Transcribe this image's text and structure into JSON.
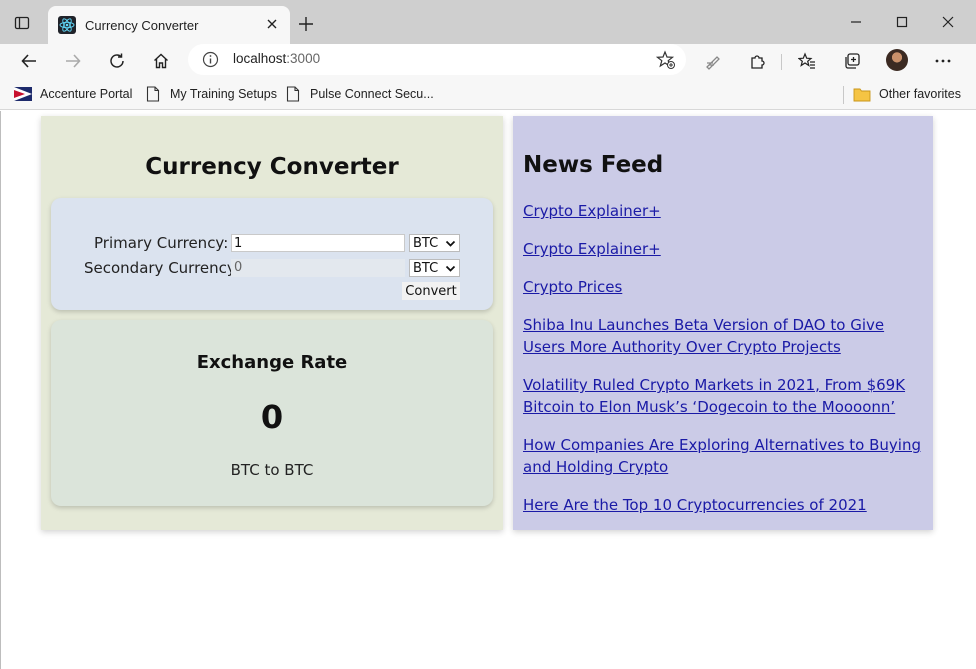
{
  "browser": {
    "tab": {
      "title": "Currency Converter"
    },
    "address": {
      "host": "localhost",
      "port": ":3000"
    },
    "bookmarks": [
      {
        "label": "Accenture Portal"
      },
      {
        "label": "My Training Setups"
      },
      {
        "label": "Pulse Connect Secu..."
      }
    ],
    "other_favorites": "Other favorites"
  },
  "converter": {
    "title": "Currency Converter",
    "primary_label": "Primary Currency:",
    "secondary_label": "Secondary Currency:",
    "primary_amount": "1",
    "secondary_amount": "0",
    "primary_currency": "BTC",
    "secondary_currency": "BTC",
    "convert_label": "Convert"
  },
  "exchange": {
    "title": "Exchange Rate",
    "value": "0",
    "pair": "BTC to BTC"
  },
  "news": {
    "title": "News Feed",
    "items": [
      "Crypto Explainer+",
      "Crypto Explainer+",
      "Crypto Prices",
      "Shiba Inu Launches Beta Version of DAO to Give Users More Authority Over Crypto Projects",
      "Volatility Ruled Crypto Markets in 2021, From $69K Bitcoin to Elon Musk’s ‘Dogecoin to the Moooonn’",
      "How Companies Are Exploring Alternatives to Buying and Holding Crypto",
      "Here Are the Top 10 Cryptocurrencies of 2021"
    ]
  },
  "colors": {
    "converter_bg": "#e5e9d7",
    "input_card_bg": "#dbe3ef",
    "rate_card_bg": "#dbe4da",
    "news_bg": "#cbcbe7",
    "link": "#1a1aa6"
  }
}
